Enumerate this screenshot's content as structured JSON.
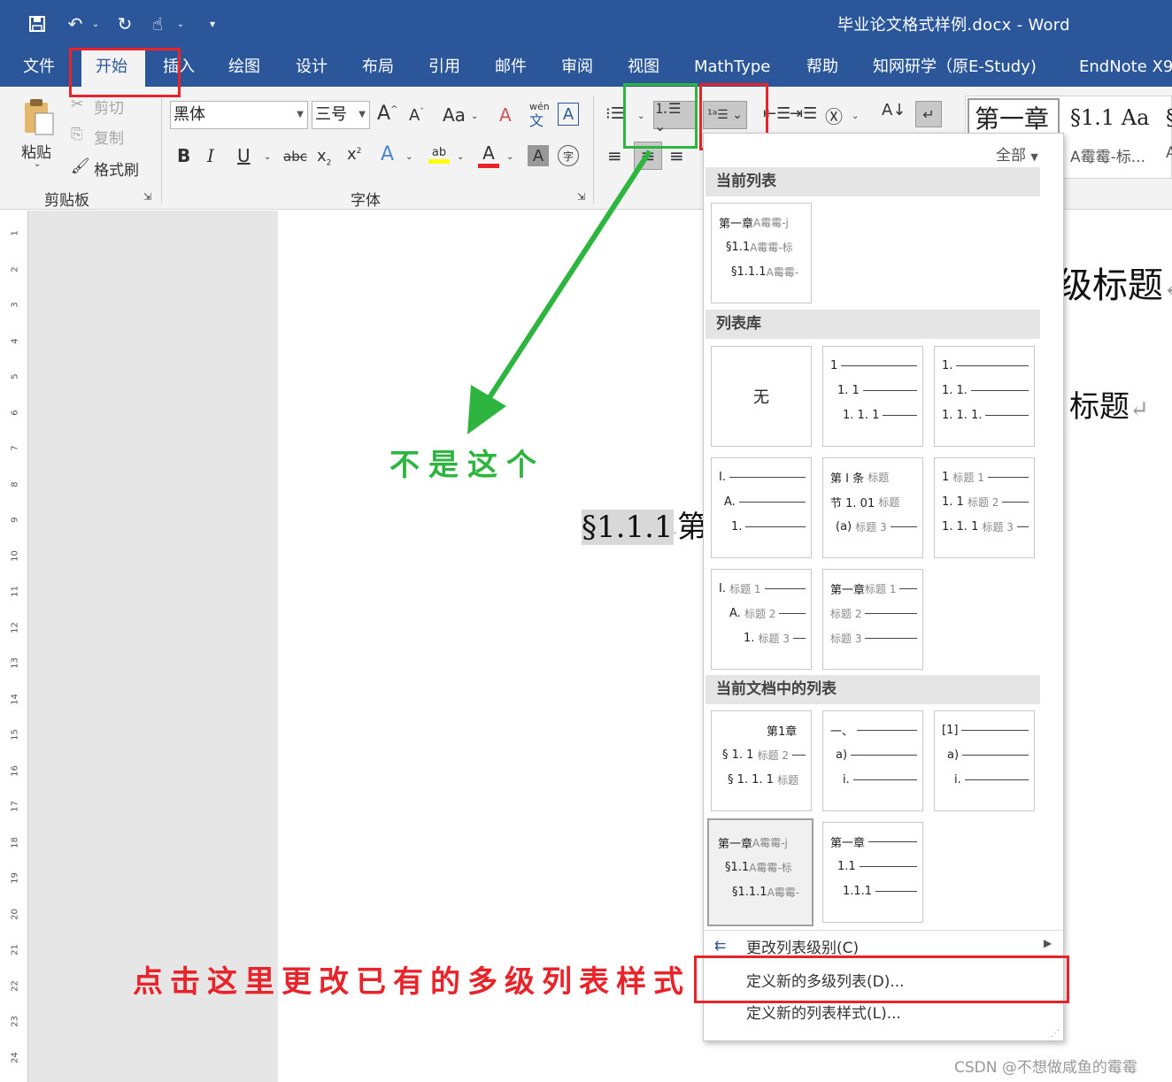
{
  "window": {
    "doc_title": "毕业论文格式样例.docx  -  Word"
  },
  "tabs": [
    "文件",
    "开始",
    "插入",
    "绘图",
    "设计",
    "布局",
    "引用",
    "邮件",
    "审阅",
    "视图",
    "MathType",
    "帮助",
    "知网研学（原E-Study)",
    "EndNote X9"
  ],
  "ribbon": {
    "clipboard": {
      "paste": "粘贴",
      "cut": "剪切",
      "copy": "复制",
      "format_painter": "格式刷",
      "group": "剪贴板"
    },
    "font": {
      "font_name": "黑体",
      "font_size": "三号",
      "change_case": "Aa",
      "group": "字体",
      "phonetic_top": "wén",
      "phonetic_bottom": "文"
    },
    "styles": {
      "gallery_item1": "第一章",
      "gallery_item2": "§1.1  Aa",
      "gallery_item2_sub": "A霉霉-标...",
      "gallery_item3": "§",
      "gallery_item3_sub": "A",
      "filter": "全部"
    }
  },
  "document": {
    "heading_right_1": "级标题",
    "heading_right_2": "标题",
    "selected_number": "§1.1.1",
    "body_text": "第",
    "ruler_numbers": [
      "1",
      "2",
      "3",
      "4",
      "5",
      "6",
      "7",
      "8",
      "9",
      "10",
      "11",
      "12",
      "13",
      "14",
      "15",
      "16",
      "17",
      "18",
      "19",
      "20",
      "21",
      "22",
      "23",
      "24"
    ]
  },
  "annotations": {
    "green_note": "不是这个",
    "red_note": "点击这里更改已有的多级列表样式"
  },
  "multilevel_panel": {
    "section_current": "当前列表",
    "section_library": "列表库",
    "section_document": "当前文档中的列表",
    "current_list": [
      "第一章",
      "A霉霉-j",
      "§1.1",
      "A霉霉-标",
      "§1.1.1",
      "A霉霉-"
    ],
    "lib_none": "无",
    "lib_numeric": [
      "1",
      "1. 1",
      "1. 1. 1"
    ],
    "lib_numeric_dot": [
      "1.",
      "1. 1.",
      "1. 1. 1."
    ],
    "lib_roman": [
      "I.",
      "A.",
      "1."
    ],
    "lib_article": [
      "第 I 条",
      "标题",
      "节 1. 01",
      "标题",
      "(a)",
      "标题 3"
    ],
    "lib_heading_num": [
      "1",
      "标题 1",
      "1. 1",
      "标题 2",
      "1. 1. 1",
      "标题 3"
    ],
    "lib_roman_heading": [
      "I.",
      "标题 1",
      "A.",
      "标题 2",
      "1.",
      "标题 3"
    ],
    "lib_chapter": [
      "第一章",
      "标题 1",
      "标题 2",
      "标题 3"
    ],
    "doc_chapter": [
      "第1章",
      "§ 1. 1",
      "标题 2",
      "§ 1. 1. 1",
      "标题"
    ],
    "doc_chinese": [
      "一、",
      "a)",
      "i."
    ],
    "doc_bracket": [
      "[1]",
      "a)",
      "i."
    ],
    "doc_selected": [
      "第一章",
      "A霉霉-j",
      "§1.1",
      "A霉霉-标",
      "§1.1.1",
      "A霉霉-"
    ],
    "doc_chapter2": [
      "第一章",
      "1.1",
      "1.1.1"
    ],
    "change_level": "更改列表级别(C)",
    "define_multilevel": "定义新的多级列表(D)...",
    "define_style": "定义新的列表样式(L)..."
  },
  "watermark": "CSDN @不想做咸鱼的霉霉",
  "colors": {
    "word_blue": "#2b579a",
    "annotation_red": "#e8232a",
    "annotation_green": "#2db540"
  }
}
